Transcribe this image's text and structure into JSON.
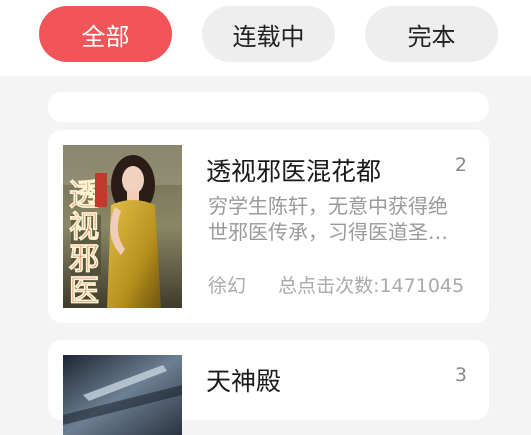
{
  "filters": {
    "all": "全部",
    "ongoing": "连载中",
    "finished": "完本"
  },
  "books": [
    {
      "title": "透视邪医混花都",
      "rank": "2",
      "description": "穷学生陈轩，无意中获得绝世邪医传承，习得医道圣…",
      "category": "徐幻",
      "clicks": "总点击次数:1471045",
      "cover_text": "透视邪医"
    },
    {
      "title": "天神殿",
      "rank": "3"
    }
  ]
}
